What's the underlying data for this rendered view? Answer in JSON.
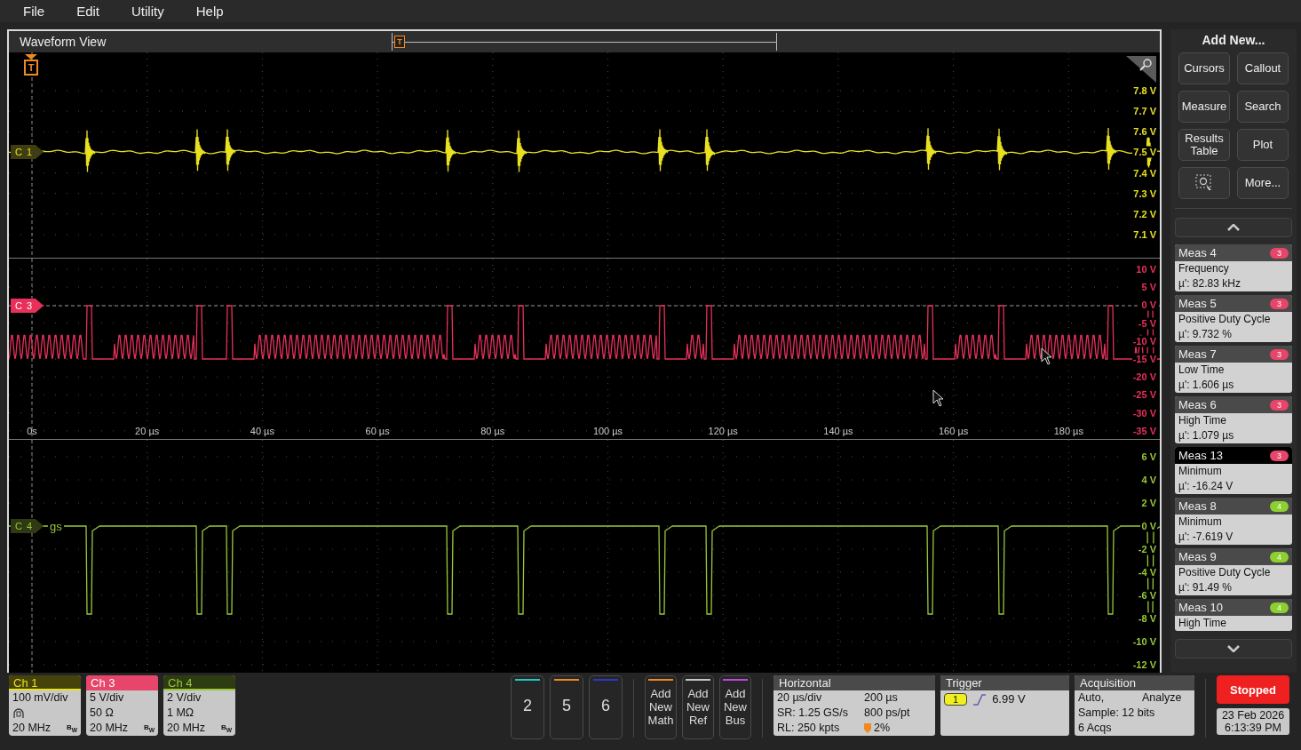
{
  "menu": [
    {
      "label": "File"
    },
    {
      "label": "Edit"
    },
    {
      "label": "Utility"
    },
    {
      "label": "Help"
    }
  ],
  "waveform_view": {
    "title": "Waveform View",
    "position_marker": "T",
    "trigger_marker": "T",
    "panes": [
      {
        "kind": "ch1",
        "color": "#e8e020",
        "badge": "C 1",
        "axis": [
          "7.8 V",
          "7.7 V",
          "7.6 V",
          "7.5 V",
          "7.4 V",
          "7.3 V",
          "7.2 V",
          "7.1 V"
        ]
      },
      {
        "kind": "ch3",
        "color": "#e8305a",
        "badge": "C 3",
        "axis": [
          "10 V",
          "5 V",
          "0 V",
          "-5 V",
          "-10 V",
          "-15 V",
          "-20 V",
          "-25 V",
          "-30 V",
          "-35 V"
        ],
        "time_axis": [
          "0s",
          "20 µs",
          "40 µs",
          "60 µs",
          "80 µs",
          "100 µs",
          "120 µs",
          "140 µs",
          "160 µs",
          "180 µs"
        ]
      },
      {
        "kind": "ch4",
        "color": "#98c838",
        "badge": "C 4",
        "label": "gs",
        "axis": [
          "6 V",
          "4 V",
          "2 V",
          "0 V",
          "-2 V",
          "-4 V",
          "-6 V",
          "-8 V",
          "-10 V",
          "-12 V"
        ]
      }
    ]
  },
  "side_panel": {
    "title": "Add New...",
    "buttons": [
      {
        "kind": "text",
        "label": "Cursors"
      },
      {
        "kind": "text",
        "label": "Callout"
      },
      {
        "kind": "text",
        "label": "Measure"
      },
      {
        "kind": "text",
        "label": "Search"
      },
      {
        "kind": "text",
        "label": "Results Table"
      },
      {
        "kind": "text",
        "label": "Plot"
      },
      {
        "kind": "zoom"
      },
      {
        "kind": "text",
        "label": "More..."
      }
    ],
    "measurements": [
      {
        "name": "Meas 4",
        "source": "3",
        "color": "#e8456a",
        "type": "Frequency",
        "value": "µ': 82.83 kHz",
        "selected": false
      },
      {
        "name": "Meas 5",
        "source": "3",
        "color": "#e8456a",
        "type": "Positive Duty Cycle",
        "value": "µ': 9.732 %",
        "selected": false
      },
      {
        "name": "Meas 7",
        "source": "3",
        "color": "#e8456a",
        "type": "Low Time",
        "value": "µ': 1.606 µs",
        "selected": false
      },
      {
        "name": "Meas 6",
        "source": "3",
        "color": "#e8456a",
        "type": "High Time",
        "value": "µ': 1.079 µs",
        "selected": false
      },
      {
        "name": "Meas 13",
        "source": "3",
        "color": "#e8456a",
        "type": "Minimum",
        "value": "µ': -16.24 V",
        "selected": true
      },
      {
        "name": "Meas 8",
        "source": "4",
        "color": "#8cd030",
        "type": "Minimum",
        "value": "µ': -7.619 V",
        "selected": false
      },
      {
        "name": "Meas 9",
        "source": "4",
        "color": "#8cd030",
        "type": "Positive Duty Cycle",
        "value": "µ': 91.49 %",
        "selected": false
      },
      {
        "name": "Meas 10",
        "source": "4",
        "color": "#8cd030",
        "type": "High Time",
        "selected": false
      }
    ]
  },
  "channels": [
    {
      "name": "Ch 1",
      "color": "#e8e020",
      "selected": false,
      "rows": [
        {
          "kind": "text",
          "text": "100 mV/div"
        },
        {
          "kind": "probe"
        },
        {
          "kind": "bandwidth",
          "text": "20 MHz",
          "mark": "B$_{W}$"
        }
      ]
    },
    {
      "name": "Ch 3",
      "color": "#e8456a",
      "selected": true,
      "rows": [
        {
          "kind": "text",
          "text": "5 V/div"
        },
        {
          "kind": "text",
          "text": "50 Ω"
        },
        {
          "kind": "bandwidth",
          "text": "20 MHz",
          "mark": "B$_{W}$"
        }
      ]
    },
    {
      "name": "Ch 4",
      "color": "#98c838",
      "selected": false,
      "rows": [
        {
          "kind": "text",
          "text": "2 V/div"
        },
        {
          "kind": "text",
          "text": "1 MΩ"
        },
        {
          "kind": "bandwidth",
          "text": "20 MHz",
          "mark": "B$_{W}$"
        }
      ]
    }
  ],
  "inactive_channels": [
    {
      "label": "2",
      "color": "#20c8c8"
    },
    {
      "label": "5",
      "color": "#f08a20"
    },
    {
      "label": "6",
      "color": "#2838c8"
    }
  ],
  "add_buttons": [
    {
      "label": "Add New Math",
      "color": "#f08a20"
    },
    {
      "label": "Add New Ref",
      "color": "#c8c8c8"
    },
    {
      "label": "Add New Bus",
      "color": "#c048e0"
    }
  ],
  "horizontal": {
    "title": "Horizontal",
    "rows": [
      [
        {
          "text": "20 µs/div"
        },
        {
          "text": "200 µs"
        }
      ],
      [
        {
          "text": "SR: 1.25 GS/s"
        },
        {
          "text": "800 ps/pt"
        }
      ],
      [
        {
          "text": "RL: 250 kpts"
        },
        {
          "text": "2%",
          "kind": "position"
        }
      ]
    ]
  },
  "trigger": {
    "title": "Trigger",
    "source": "1",
    "threshold": "6.99 V"
  },
  "acquisition": {
    "title": "Acquisition",
    "rows": [
      [
        "Auto,",
        "Analyze"
      ],
      [
        "Sample: 12 bits"
      ],
      [
        "6 Acqs"
      ]
    ]
  },
  "run_button": {
    "label": "Stopped",
    "running": false
  },
  "datetime": {
    "date": "23 Feb 2026",
    "time": "6:13:39 PM"
  }
}
